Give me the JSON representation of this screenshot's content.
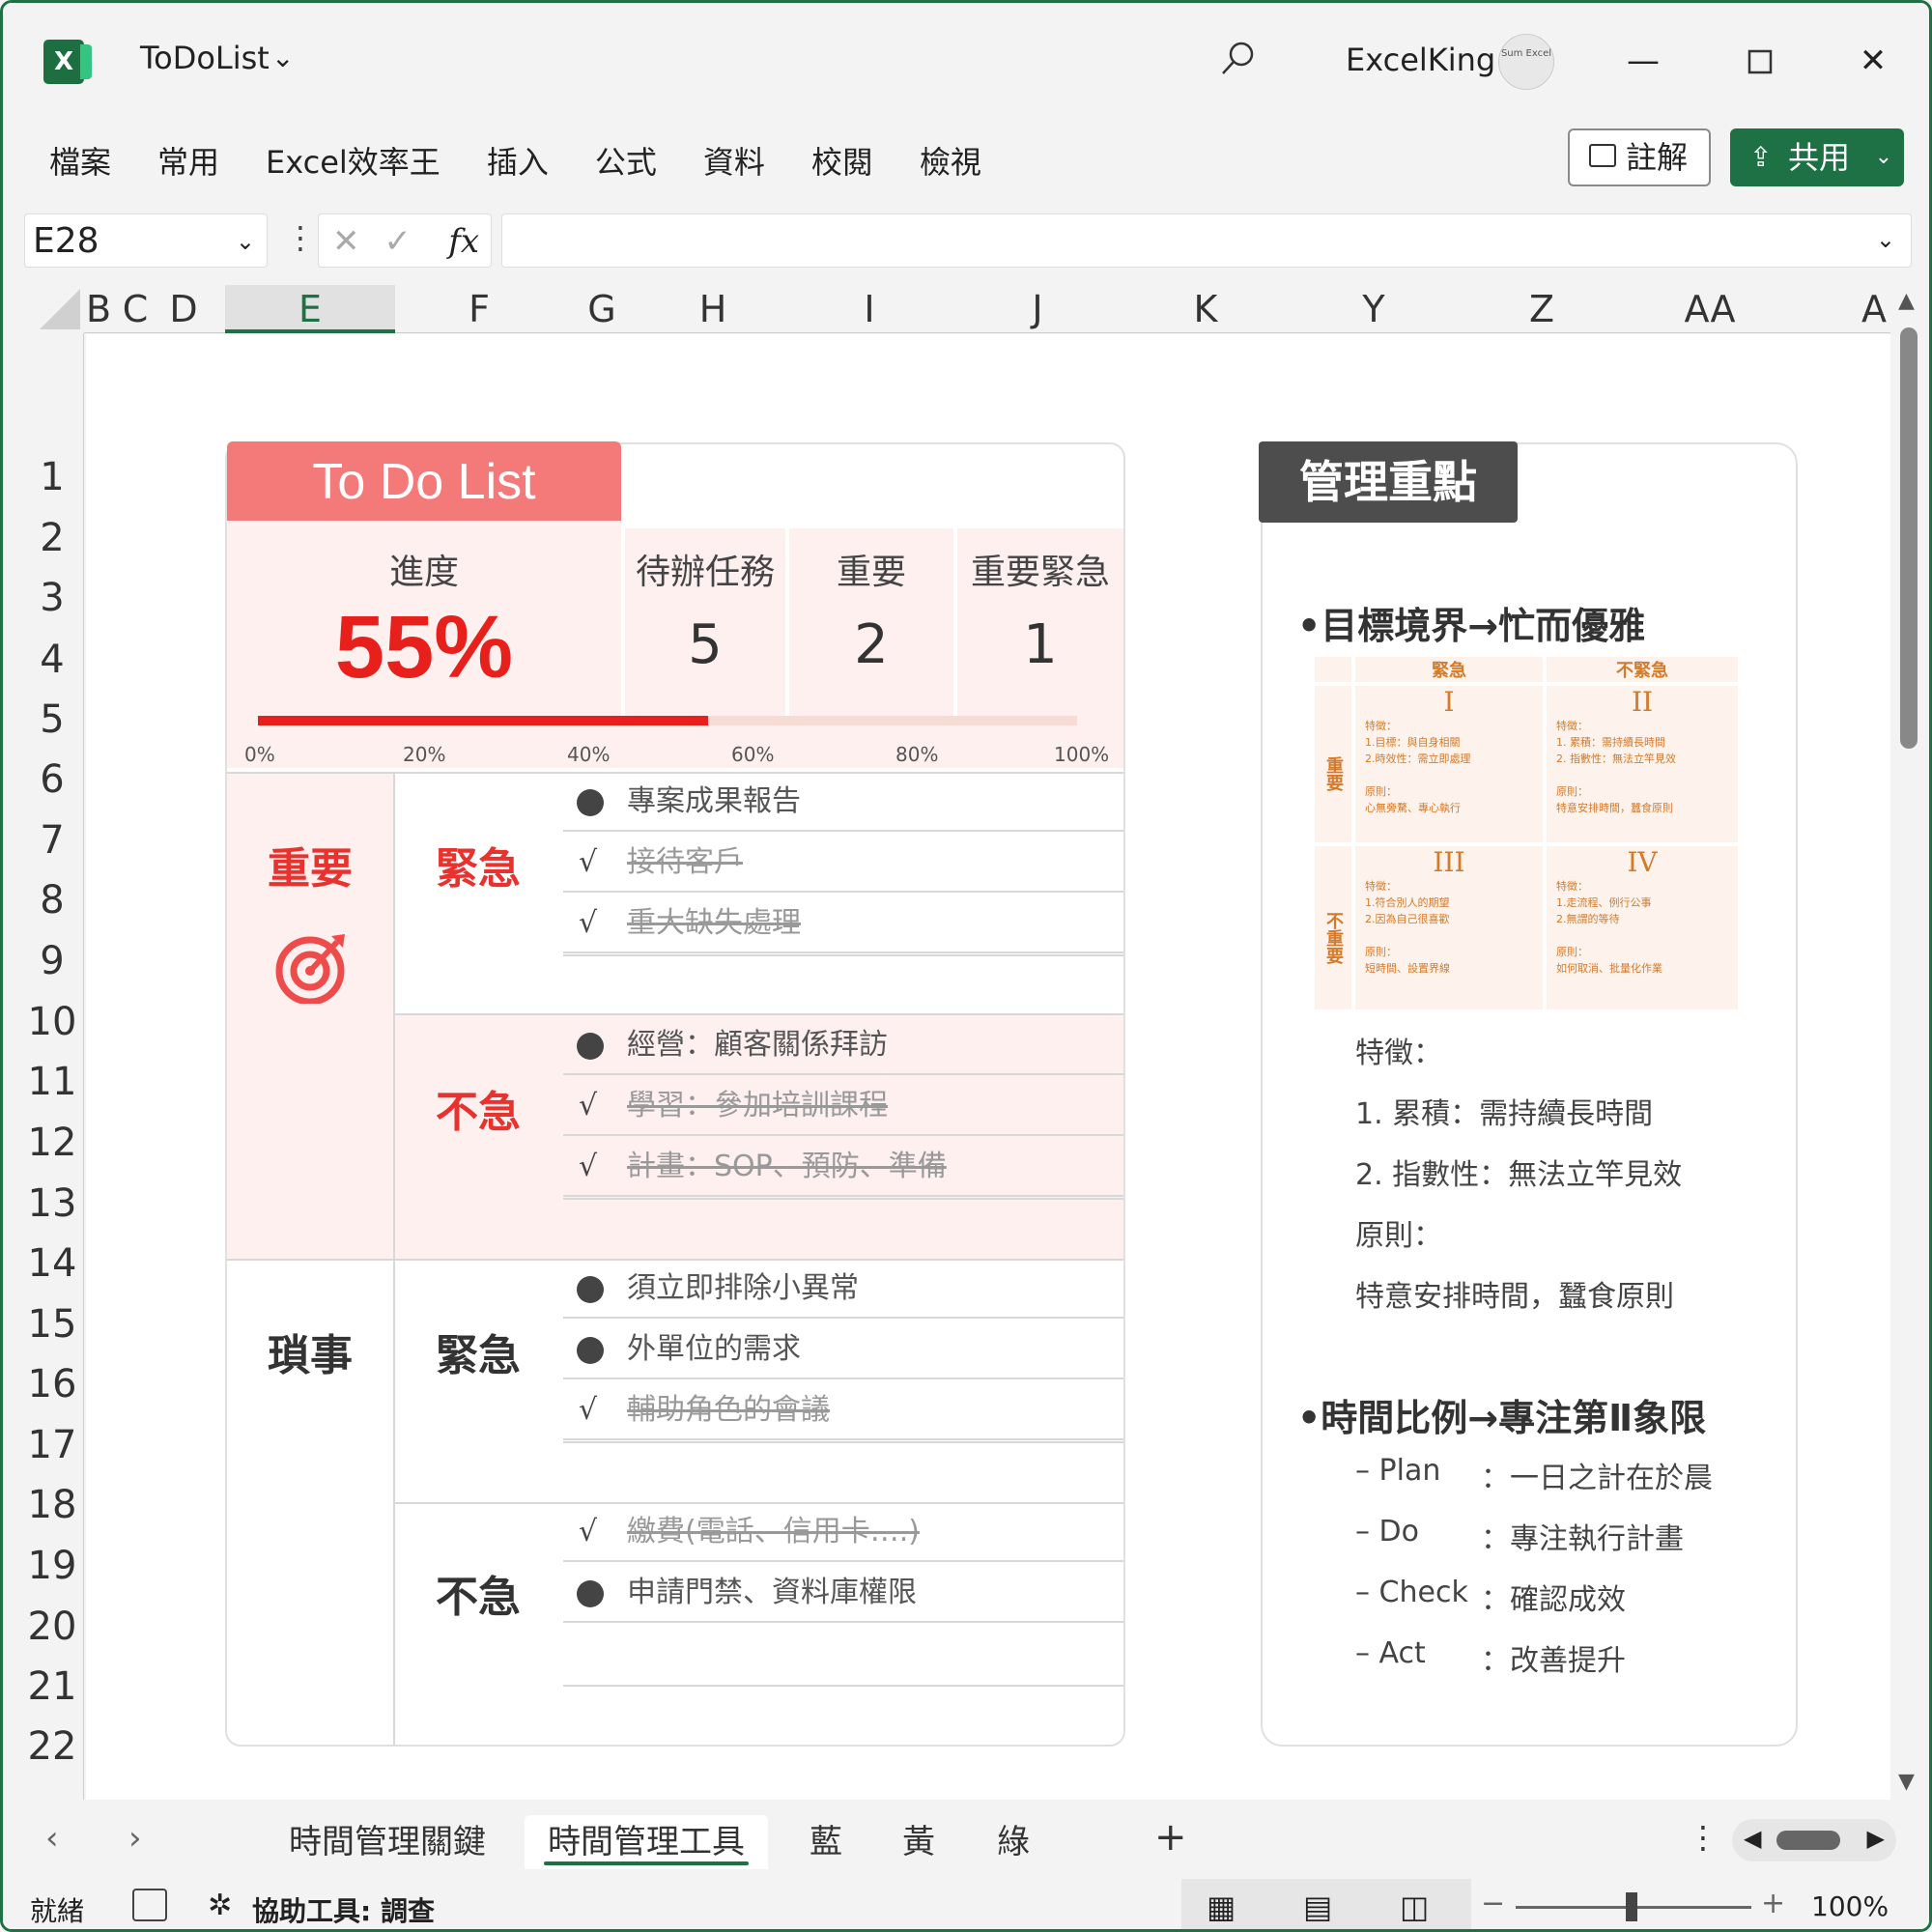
{
  "window": {
    "app_icon": "excel-icon",
    "file_title": "ToDoList",
    "user_name": "ExcelKing",
    "avatar_text": "Sum Excel"
  },
  "menu": [
    "檔案",
    "常用",
    "Excel效率王",
    "插入",
    "公式",
    "資料",
    "校閱",
    "檢視"
  ],
  "buttons": {
    "comment": "註解",
    "share": "共用"
  },
  "formula_bar": {
    "name_box": "E28",
    "fx": "fx",
    "formula": ""
  },
  "columns": [
    "B",
    "C",
    "D",
    "E",
    "F",
    "G",
    "H",
    "I",
    "J",
    "K",
    "Y",
    "Z",
    "AA",
    "A"
  ],
  "rows": [
    "1",
    "2",
    "3",
    "4",
    "5",
    "6",
    "7",
    "8",
    "9",
    "10",
    "11",
    "12",
    "13",
    "14",
    "15",
    "16",
    "17",
    "18",
    "19",
    "20",
    "21",
    "22"
  ],
  "todo": {
    "title": "To Do List",
    "progress_label": "進度",
    "progress_value": "55%",
    "progress_fraction": 0.55,
    "stats": [
      {
        "label": "待辦任務",
        "value": "5"
      },
      {
        "label": "重要",
        "value": "2"
      },
      {
        "label": "重要緊急",
        "value": "1"
      }
    ],
    "ticks": [
      "0%",
      "20%",
      "40%",
      "60%",
      "80%",
      "100%"
    ],
    "cat_important": "重要",
    "cat_trivial": "瑣事",
    "urgent": "緊急",
    "not_urgent": "不急",
    "items": [
      {
        "text": "專案成果報告",
        "done": false,
        "mark": "●"
      },
      {
        "text": "接待客戶",
        "done": true,
        "mark": "√"
      },
      {
        "text": "重大缺失處理",
        "done": true,
        "mark": "√"
      },
      {
        "text": "經營：顧客關係拜訪",
        "done": false,
        "mark": "●"
      },
      {
        "text": "學習：參加培訓課程",
        "done": true,
        "mark": "√"
      },
      {
        "text": "計畫：SOP、預防、準備",
        "done": true,
        "mark": "√"
      },
      {
        "text": "須立即排除小異常",
        "done": false,
        "mark": "●"
      },
      {
        "text": "外單位的需求",
        "done": false,
        "mark": "●"
      },
      {
        "text": "輔助角色的會議",
        "done": true,
        "mark": "√"
      },
      {
        "text": "繳費(電話、信用卡….)",
        "done": true,
        "mark": "√"
      },
      {
        "text": "申請門禁、資料庫權限",
        "done": false,
        "mark": "●"
      }
    ]
  },
  "mgmt": {
    "title": "管理重點",
    "heading1": "•目標境界→忙而優雅",
    "matrix": {
      "col_headers": [
        "緊急",
        "不緊急"
      ],
      "row_headers": [
        "重要",
        "不重要"
      ],
      "romans": [
        "I",
        "II",
        "III",
        "IV"
      ],
      "cells": [
        "特徵：\n1.目標：與自身相關\n2.時效性：需立即處理\n\n原則：\n心無旁騖、專心執行",
        "特徵：\n1. 累積：需持續長時間\n2. 指數性：無法立竿見效\n\n原則：\n特意安排時間，蠶食原則",
        "特徵：\n1.符合別人的期望\n2.因為自己很喜歡\n\n原則：\n短時間、設置界線",
        "特徵：\n1.走流程、例行公事\n2.無謂的等待\n\n原則：\n如何取消、批量化作業"
      ]
    },
    "lines1": [
      "特徵：",
      "1. 累積：需持續長時間",
      "2. 指數性：無法立竿見效",
      "原則：",
      "特意安排時間，蠶食原則"
    ],
    "heading2": "•時間比例→專注第Ⅱ象限",
    "pdca": [
      {
        "k": "– Plan",
        "v": "：一日之計在於晨"
      },
      {
        "k": "– Do",
        "v": "：專注執行計畫"
      },
      {
        "k": "– Check",
        "v": "：確認成效"
      },
      {
        "k": "– Act",
        "v": "：改善提升"
      }
    ]
  },
  "sheet_tabs": [
    "時間管理關鍵",
    "時間管理工具",
    "藍",
    "黃",
    "綠"
  ],
  "active_tab": "時間管理工具",
  "status": {
    "ready": "就緒",
    "accessibility": "協助工具: 調查",
    "zoom": "100%"
  }
}
